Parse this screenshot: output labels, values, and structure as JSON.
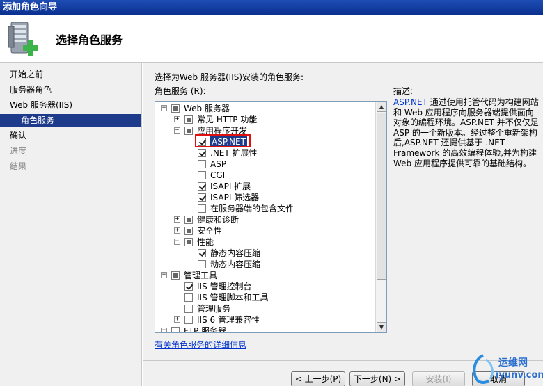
{
  "window": {
    "title": "添加角色向导"
  },
  "header": {
    "title": "选择角色服务"
  },
  "nav": {
    "items": [
      {
        "label": "开始之前",
        "state": "normal"
      },
      {
        "label": "服务器角色",
        "state": "normal"
      },
      {
        "label": "Web 服务器(IIS)",
        "state": "normal"
      },
      {
        "label": "角色服务",
        "state": "selected"
      },
      {
        "label": "确认",
        "state": "normal"
      },
      {
        "label": "进度",
        "state": "disabled"
      },
      {
        "label": "结果",
        "state": "disabled"
      }
    ]
  },
  "main": {
    "prompt": "选择为Web 服务器(IIS)安装的角色服务:",
    "roles_label": "角色服务 (R):",
    "desc_label": "描述:",
    "more_link": "有关角色服务的详细信息"
  },
  "tree": {
    "items": [
      {
        "label": "Web 服务器",
        "expander": "-",
        "check": "partial"
      },
      {
        "label": "常见 HTTP 功能",
        "expander": "+",
        "check": "partial"
      },
      {
        "label": "应用程序开发",
        "expander": "-",
        "check": "partial"
      },
      {
        "label": "ASP.NET",
        "check": "checked",
        "selected": true
      },
      {
        "label": ".NET 扩展性",
        "check": "checked"
      },
      {
        "label": "ASP",
        "check": "unchecked"
      },
      {
        "label": "CGI",
        "check": "unchecked"
      },
      {
        "label": "ISAPI 扩展",
        "check": "checked"
      },
      {
        "label": "ISAPI 筛选器",
        "check": "checked"
      },
      {
        "label": "在服务器端的包含文件",
        "check": "unchecked"
      },
      {
        "label": "健康和诊断",
        "expander": "+",
        "check": "partial"
      },
      {
        "label": "安全性",
        "expander": "+",
        "check": "partial"
      },
      {
        "label": "性能",
        "expander": "-",
        "check": "partial"
      },
      {
        "label": "静态内容压缩",
        "check": "checked"
      },
      {
        "label": "动态内容压缩",
        "check": "unchecked"
      },
      {
        "label": "管理工具",
        "expander": "-",
        "check": "partial"
      },
      {
        "label": "IIS 管理控制台",
        "check": "checked"
      },
      {
        "label": "IIS 管理脚本和工具",
        "check": "unchecked"
      },
      {
        "label": "管理服务",
        "check": "unchecked"
      },
      {
        "label": "IIS 6 管理兼容性",
        "expander": "+",
        "check": "unchecked"
      },
      {
        "label": "FTP 服务器",
        "expander": "-",
        "check": "unchecked"
      }
    ]
  },
  "description": {
    "link": "ASP.NET",
    "text": " 通过使用托管代码为构建网站和 Web 应用程序向服务器端提供面向对象的编程环境。ASP.NET 并不仅仅是 ASP 的一个新版本。经过整个重新架构后,ASP.NET 还提供基于 .NET Framework 的高效编程体验,并为构建 Web 应用程序提供可靠的基础结构。"
  },
  "buttons": {
    "prev": "< 上一步(P)",
    "next": "下一步(N) >",
    "install": "安装(I)",
    "cancel": "取消"
  },
  "watermark": {
    "brand": "运维网",
    "domain": "iyunv.com"
  }
}
